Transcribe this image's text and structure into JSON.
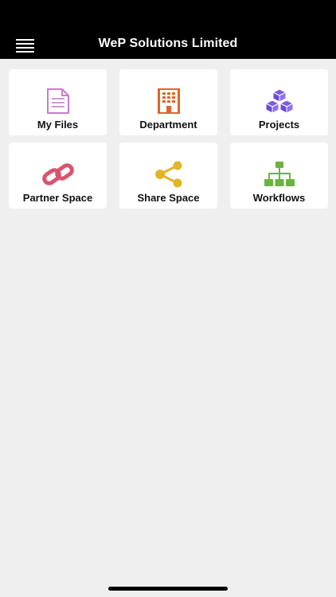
{
  "header": {
    "title": "WeP Solutions Limited",
    "menu_icon": "hamburger-menu-icon"
  },
  "tiles": [
    {
      "label": "My Files",
      "icon": "document-icon",
      "color": "#c77dcb"
    },
    {
      "label": "Department",
      "icon": "building-icon",
      "color": "#e0642b"
    },
    {
      "label": "Projects",
      "icon": "cubes-icon",
      "color": "#7a5ce6"
    },
    {
      "label": "Partner Space",
      "icon": "link-icon",
      "color": "#d9536f"
    },
    {
      "label": "Share Space",
      "icon": "share-icon",
      "color": "#e0b52b"
    },
    {
      "label": "Workflows",
      "icon": "sitemap-icon",
      "color": "#6cb33f"
    }
  ]
}
